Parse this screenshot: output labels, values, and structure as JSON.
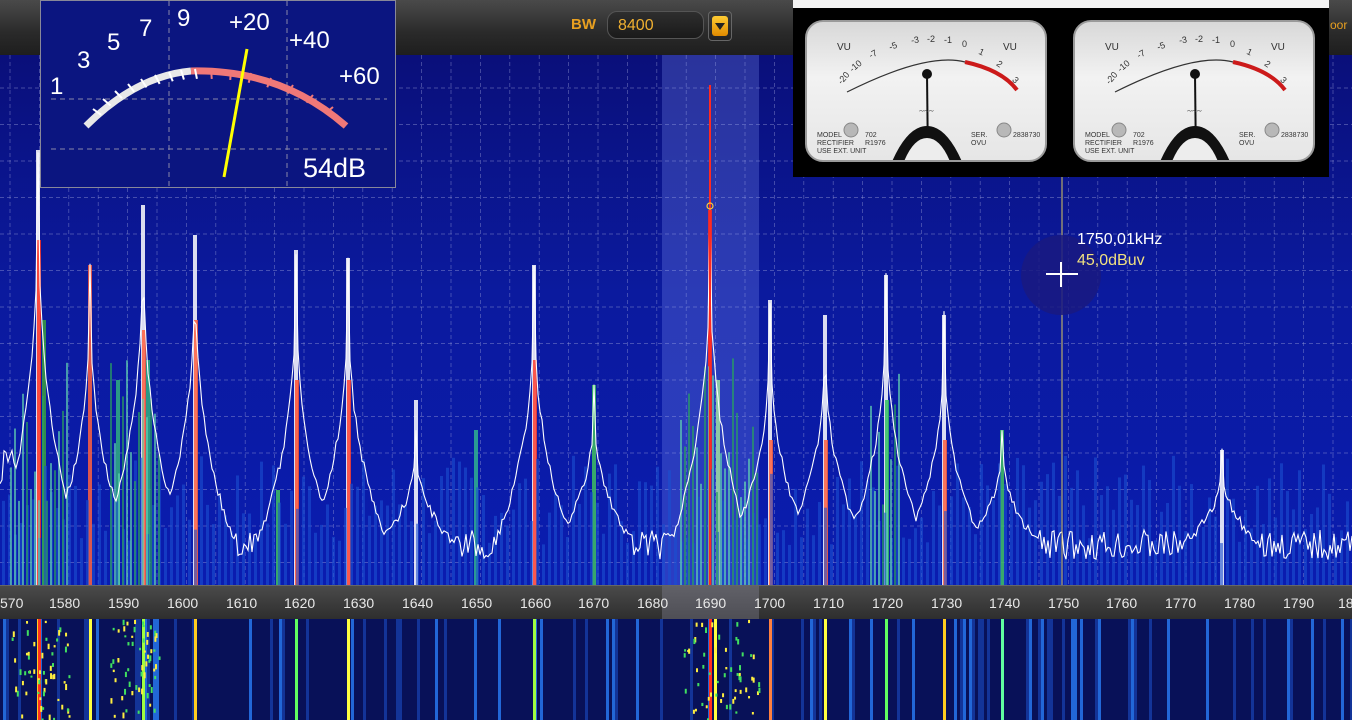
{
  "topbar": {
    "bw_label": "BW",
    "bw_value": "8400",
    "bw_dropdown_icon": "chevron-down-icon",
    "right_text_fragment": "oor"
  },
  "smeter": {
    "scale_labels": [
      "1",
      "3",
      "5",
      "7",
      "9",
      "+20",
      "+40",
      "+60"
    ],
    "readout": "54dB",
    "needle_color": "#ffff00"
  },
  "vu_meters": [
    {
      "label_left": "VU",
      "label_right": "VU",
      "scale": [
        "-20",
        "-10",
        "-7",
        "-5",
        "-3",
        "-2",
        "-1",
        "0",
        "1",
        "2",
        "3"
      ],
      "model_text": [
        "MODEL",
        "RECTIFIER",
        "USE EXT. UNIT"
      ],
      "model_values": [
        "702",
        "R1976"
      ],
      "ser_text": [
        "SER.",
        "OVU"
      ],
      "ser_value": "2838730",
      "red_zone_color": "#cc1a1a"
    },
    {
      "label_left": "VU",
      "label_right": "VU",
      "scale": [
        "-20",
        "-10",
        "-7",
        "-5",
        "-3",
        "-2",
        "-1",
        "0",
        "1",
        "2",
        "3"
      ],
      "model_text": [
        "MODEL",
        "RECTIFIER",
        "USE EXT. UNIT"
      ],
      "model_values": [
        "702",
        "R1976"
      ],
      "ser_text": [
        "SER.",
        "OVU"
      ],
      "ser_value": "2838730",
      "red_zone_color": "#cc1a1a"
    }
  ],
  "spectrum": {
    "axis_ticks": [
      "570",
      "1580",
      "1590",
      "1600",
      "1610",
      "1620",
      "1630",
      "1640",
      "1650",
      "1660",
      "1670",
      "1680",
      "1690",
      "1700",
      "1710",
      "1720",
      "1730",
      "1740",
      "1750",
      "1760",
      "1770",
      "1780",
      "1790",
      "18"
    ],
    "cursor_frequency": "1750,01kHz",
    "cursor_level": "45,0dBuv",
    "tuned_frequency_khz": 1690,
    "cursor_frequency_khz": 1750,
    "background_color": "#0b1a9e",
    "trace_color": "#ffffff",
    "peak_color": "#ff3020"
  }
}
